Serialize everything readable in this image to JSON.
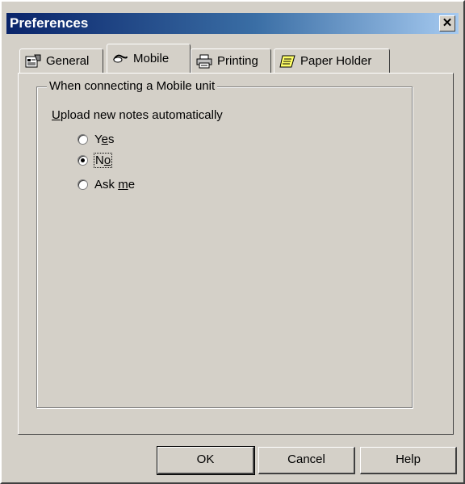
{
  "window": {
    "title": "Preferences",
    "close_glyph": "✕"
  },
  "tabs": [
    {
      "label": "General",
      "icon": "general-settings-icon",
      "active": false
    },
    {
      "label": "Mobile",
      "icon": "mobile-unit-icon",
      "active": true
    },
    {
      "label": "Printing",
      "icon": "printer-icon",
      "active": false
    },
    {
      "label": "Paper Holder",
      "icon": "paper-holder-icon",
      "active": false
    }
  ],
  "group": {
    "title": "When connecting a Mobile unit"
  },
  "upload": {
    "label_accel": "U",
    "label_rest": "pload new notes automatically",
    "options": [
      {
        "pre": "Y",
        "accel": "e",
        "post": "s",
        "selected": false
      },
      {
        "pre": "N",
        "accel": "o",
        "post": "",
        "selected": true
      },
      {
        "pre": "Ask ",
        "accel": "m",
        "post": "e",
        "selected": false
      }
    ]
  },
  "buttons": {
    "ok": "OK",
    "cancel": "Cancel",
    "help": "Help"
  }
}
